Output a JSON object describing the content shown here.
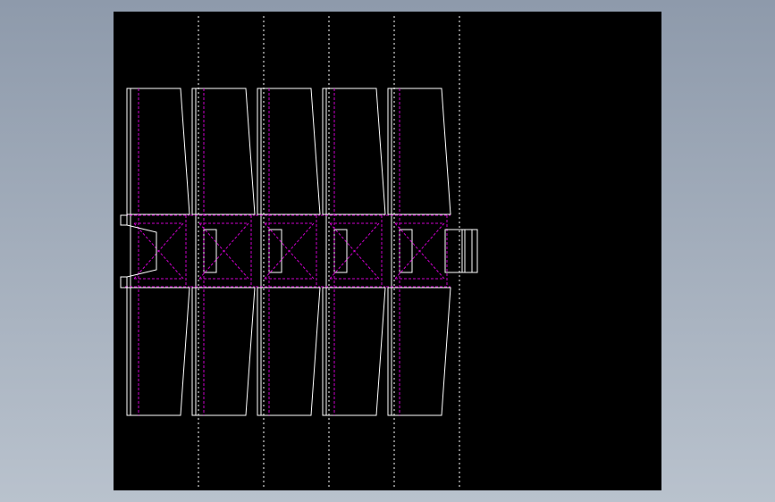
{
  "drawing": {
    "background_color": "#000000",
    "desktop_color": "#a5b0bf",
    "line_color": "#ffffff",
    "hidden_line_color": "#cc00cc",
    "center_line_color": "#ffffff",
    "segment_count": 5
  }
}
